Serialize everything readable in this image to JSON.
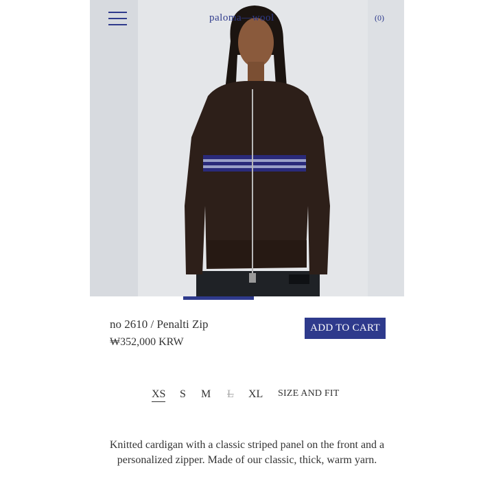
{
  "header": {
    "menu_icon": "hamburger-icon",
    "logo": "paloma—wool",
    "cart_count": "(0)"
  },
  "product": {
    "name": "no 2610 / Penalti Zip",
    "price": "₩352,000 KRW",
    "add_to_cart": "ADD TO CART",
    "image_alt": "Model wearing dark brown knitted zip cardigan with blue and grey stripes"
  },
  "sizes": {
    "options": [
      "XS",
      "S",
      "M",
      "L",
      "XL"
    ],
    "selected": "XS",
    "unavailable": [
      "L"
    ],
    "size_and_fit": "SIZE AND FIT"
  },
  "description": "Knitted cardigan with a classic striped panel on the front and a personalized zipper. Made of our classic, thick, warm yarn.",
  "colors": {
    "accent": "#2e3a8c",
    "background": "#ffffff",
    "text": "#333333"
  }
}
